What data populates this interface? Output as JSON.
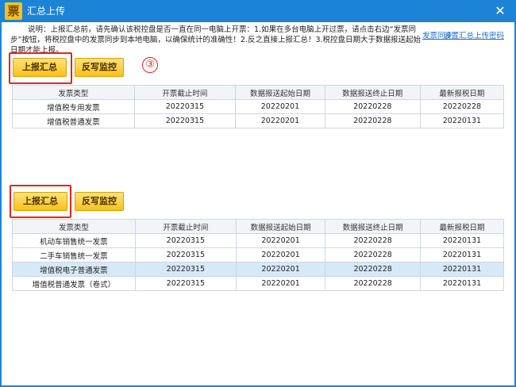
{
  "window": {
    "title": "汇总上传",
    "app_icon_glyph": "票",
    "close_glyph": "✕"
  },
  "notice": {
    "text": "说明：上报汇总前，请先确认该税控盘是否一直在同一电脑上开票：1.如果在多台电脑上开过票，请点击右边“发票同步”按钮，将税控盘中的发票同步到本地电脑，以确保统计的准确性！2.反之直接上报汇总！3.税控盘日期大于数据报送起始日期才能上报。"
  },
  "links": {
    "invoice_sync": "发票同步",
    "set_password": "设置汇总上传密码"
  },
  "step_mark": "③",
  "section1": {
    "report_button": "上报汇总",
    "writeback_button": "反写监控",
    "columns": [
      "发票类型",
      "开票截止时间",
      "数据报送起始日期",
      "数据报送终止日期",
      "最新报税日期"
    ],
    "rows": [
      [
        "增值税专用发票",
        "20220315",
        "20220201",
        "20220228",
        "20220228"
      ],
      [
        "增值税普通发票",
        "20220315",
        "20220201",
        "20220228",
        "20220131"
      ]
    ]
  },
  "section2": {
    "report_button": "上报汇总",
    "writeback_button": "反写监控",
    "columns": [
      "发票类型",
      "开票截止时间",
      "数据报送起始日期",
      "数据报送终止日期",
      "最新报税日期"
    ],
    "rows": [
      [
        "机动车销售统一发票",
        "20220315",
        "20220201",
        "20220228",
        "20220131"
      ],
      [
        "二手车销售统一发票",
        "20220315",
        "20220201",
        "20220228",
        "20220131"
      ],
      [
        "增值税电子普通发票",
        "20220315",
        "20220201",
        "20220228",
        "20220131"
      ],
      [
        "增值税普通发票（卷式）",
        "20220315",
        "20220201",
        "20220228",
        "20220131"
      ]
    ],
    "selected_row": 2
  },
  "colors": {
    "titlebar": "#1d83d4",
    "highlight": "#e2261d",
    "button": "#f6c21c",
    "selected_row": "#d6e9f8"
  }
}
